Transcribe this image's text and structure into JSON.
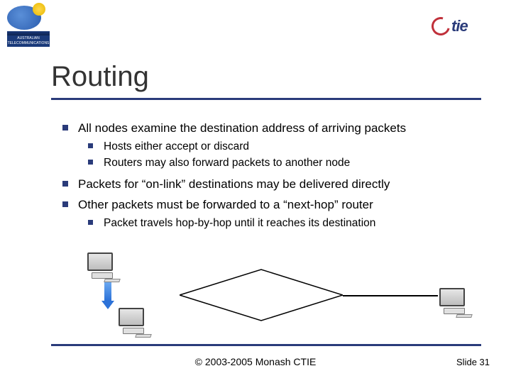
{
  "logo_left_caption": "AUSTRALIAN TELECOMMUNICATIONS",
  "logo_right_text": "tie",
  "title": "Routing",
  "bullets": {
    "b1": "All nodes examine the destination address of arriving packets",
    "b1_1": "Hosts either accept or discard",
    "b1_2": "Routers may also forward packets to another node",
    "b2": "Packets for “on-link” destinations may be delivered directly",
    "b3": "Other packets must be forwarded to a “next-hop” router",
    "b3_1": "Packet travels hop-by-hop until it reaches its destination"
  },
  "footer": {
    "copyright": "© 2003-2005 Monash CTIE",
    "slide": "Slide 31"
  }
}
